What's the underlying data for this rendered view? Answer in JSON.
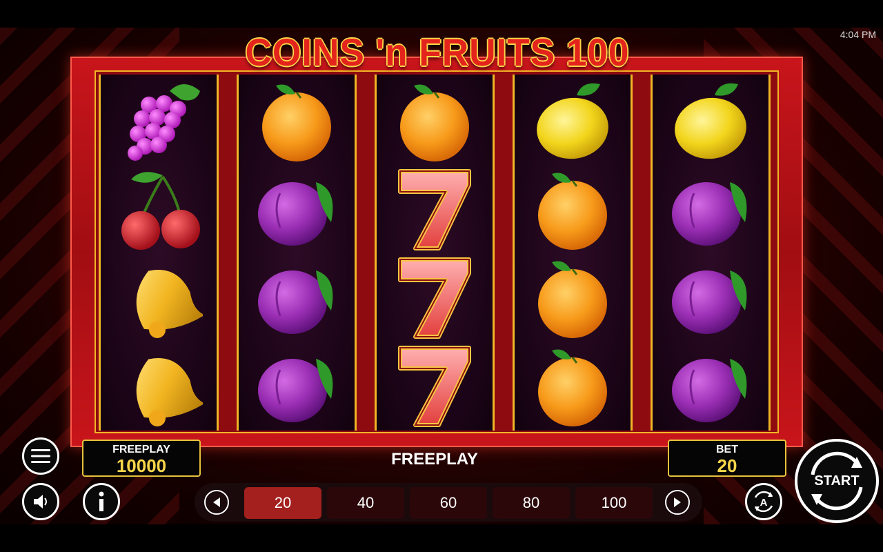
{
  "status_bar": {
    "time": "4:04 PM"
  },
  "game": {
    "title": "COINS 'n FRUITS 100"
  },
  "reels": [
    [
      "grapes",
      "cherries",
      "bell",
      "bell"
    ],
    [
      "orange",
      "plum",
      "plum",
      "plum"
    ],
    [
      "orange",
      "seven",
      "seven",
      "seven"
    ],
    [
      "lemon",
      "orange",
      "orange",
      "orange"
    ],
    [
      "lemon",
      "plum",
      "plum",
      "plum"
    ]
  ],
  "balance": {
    "label": "FREEPLAY",
    "value": "10000"
  },
  "bet": {
    "label": "BET",
    "value": "20"
  },
  "status_text": "FREEPLAY",
  "bet_options": [
    "20",
    "40",
    "60",
    "80",
    "100"
  ],
  "selected_bet": "20",
  "start_label": "START",
  "colors": {
    "frame": "#c8151b",
    "gold": "#f2b526",
    "reel_bg": "#1b0417",
    "selected_bet": "#a3201e"
  }
}
